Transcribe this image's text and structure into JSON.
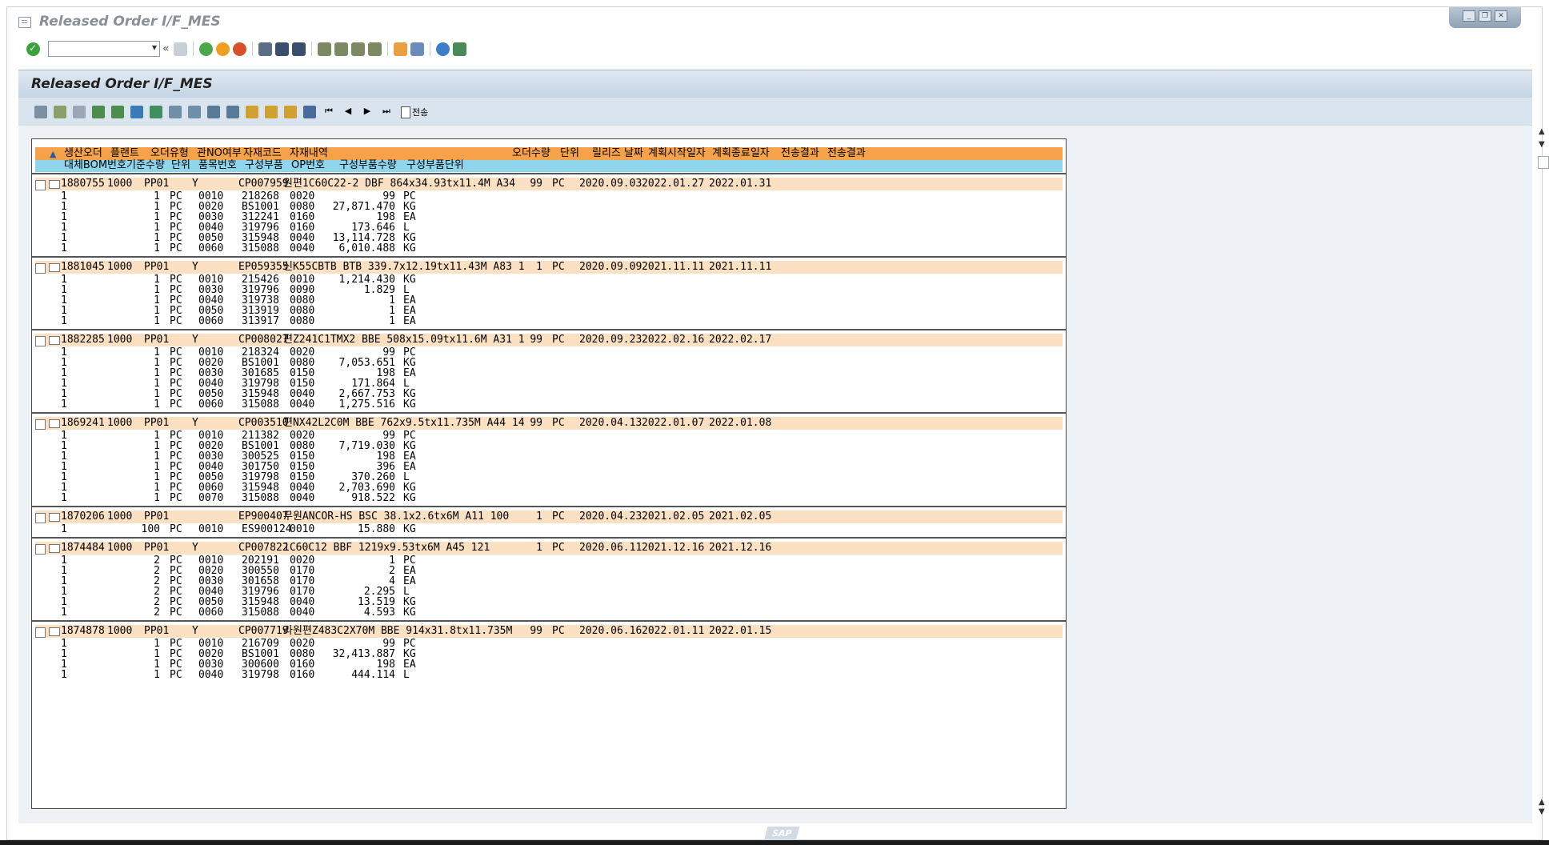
{
  "window": {
    "title": "Released Order I/F_MES"
  },
  "app": {
    "title": "Released Order I/F_MES",
    "send_button": "전송"
  },
  "command_field": {
    "value": ""
  },
  "header_row1": [
    "생산오더",
    "플랜트",
    "오더유형",
    "관NO여부",
    "자재코드",
    "자재내역",
    "오더수량",
    "단위",
    "릴리즈 날짜",
    "계획시작일자",
    "계획종료일자",
    "전송결과",
    "전송결과"
  ],
  "header_row2": [
    "대체BOM번호",
    "기준수량",
    "단위",
    "품목번호",
    "구성부품",
    "OP번호",
    "구성부품수량",
    "구성부품단위"
  ],
  "orders": [
    {
      "order": "1880755",
      "plant": "1000",
      "type": "PP01",
      "flag": "Y",
      "material": "CP007959",
      "desc": "원편1C60C22-2 DBF 864x34.93tx11.4M A34",
      "qty": "99",
      "unit": "PC",
      "release": "2020.09.03",
      "start": "2022.01.27",
      "end": "2022.01.31",
      "items": [
        {
          "alt": "1",
          "base": "1",
          "bunit": "PC",
          "item": "0010",
          "comp": "218268",
          "op": "0020",
          "cqty": "99",
          "cunit": "PC"
        },
        {
          "alt": "1",
          "base": "1",
          "bunit": "PC",
          "item": "0020",
          "comp": "BS1001",
          "op": "0080",
          "cqty": "27,871.470",
          "cunit": "KG"
        },
        {
          "alt": "1",
          "base": "1",
          "bunit": "PC",
          "item": "0030",
          "comp": "312241",
          "op": "0160",
          "cqty": "198",
          "cunit": "EA"
        },
        {
          "alt": "1",
          "base": "1",
          "bunit": "PC",
          "item": "0040",
          "comp": "319796",
          "op": "0160",
          "cqty": "173.646",
          "cunit": "L"
        },
        {
          "alt": "1",
          "base": "1",
          "bunit": "PC",
          "item": "0050",
          "comp": "315948",
          "op": "0040",
          "cqty": "13,114.728",
          "cunit": "KG"
        },
        {
          "alt": "1",
          "base": "1",
          "bunit": "PC",
          "item": "0060",
          "comp": "315088",
          "op": "0040",
          "cqty": "6,010.488",
          "cunit": "KG"
        }
      ]
    },
    {
      "order": "1881045",
      "plant": "1000",
      "type": "PP01",
      "flag": "Y",
      "material": "EP059355",
      "desc": "신K55CBTB BTB 339.7x12.19tx11.43M A83 1",
      "qty": "1",
      "unit": "PC",
      "release": "2020.09.09",
      "start": "2021.11.11",
      "end": "2021.11.11",
      "items": [
        {
          "alt": "1",
          "base": "1",
          "bunit": "PC",
          "item": "0010",
          "comp": "215426",
          "op": "0010",
          "cqty": "1,214.430",
          "cunit": "KG"
        },
        {
          "alt": "1",
          "base": "1",
          "bunit": "PC",
          "item": "0030",
          "comp": "319796",
          "op": "0090",
          "cqty": "1.829",
          "cunit": "L"
        },
        {
          "alt": "1",
          "base": "1",
          "bunit": "PC",
          "item": "0040",
          "comp": "319738",
          "op": "0080",
          "cqty": "1",
          "cunit": "EA"
        },
        {
          "alt": "1",
          "base": "1",
          "bunit": "PC",
          "item": "0050",
          "comp": "313919",
          "op": "0080",
          "cqty": "1",
          "cunit": "EA"
        },
        {
          "alt": "1",
          "base": "1",
          "bunit": "PC",
          "item": "0060",
          "comp": "313917",
          "op": "0080",
          "cqty": "1",
          "cunit": "EA"
        }
      ]
    },
    {
      "order": "1882285",
      "plant": "1000",
      "type": "PP01",
      "flag": "Y",
      "material": "CP008027",
      "desc": "편Z241C1TMX2 BBE 508x15.09tx11.6M A31 1",
      "qty": "99",
      "unit": "PC",
      "release": "2020.09.23",
      "start": "2022.02.16",
      "end": "2022.02.17",
      "items": [
        {
          "alt": "1",
          "base": "1",
          "bunit": "PC",
          "item": "0010",
          "comp": "218324",
          "op": "0020",
          "cqty": "99",
          "cunit": "PC"
        },
        {
          "alt": "1",
          "base": "1",
          "bunit": "PC",
          "item": "0020",
          "comp": "BS1001",
          "op": "0080",
          "cqty": "7,053.651",
          "cunit": "KG"
        },
        {
          "alt": "1",
          "base": "1",
          "bunit": "PC",
          "item": "0030",
          "comp": "301685",
          "op": "0150",
          "cqty": "198",
          "cunit": "EA"
        },
        {
          "alt": "1",
          "base": "1",
          "bunit": "PC",
          "item": "0040",
          "comp": "319798",
          "op": "0150",
          "cqty": "171.864",
          "cunit": "L"
        },
        {
          "alt": "1",
          "base": "1",
          "bunit": "PC",
          "item": "0050",
          "comp": "315948",
          "op": "0040",
          "cqty": "2,667.753",
          "cunit": "KG"
        },
        {
          "alt": "1",
          "base": "1",
          "bunit": "PC",
          "item": "0060",
          "comp": "315088",
          "op": "0040",
          "cqty": "1,275.516",
          "cunit": "KG"
        }
      ]
    },
    {
      "order": "1869241",
      "plant": "1000",
      "type": "PP01",
      "flag": "Y",
      "material": "CP003510",
      "desc": "편NX42L2C0M BBE 762x9.5tx11.735M A44 14",
      "qty": "99",
      "unit": "PC",
      "release": "2020.04.13",
      "start": "2022.01.07",
      "end": "2022.01.08",
      "items": [
        {
          "alt": "1",
          "base": "1",
          "bunit": "PC",
          "item": "0010",
          "comp": "211382",
          "op": "0020",
          "cqty": "99",
          "cunit": "PC"
        },
        {
          "alt": "1",
          "base": "1",
          "bunit": "PC",
          "item": "0020",
          "comp": "BS1001",
          "op": "0080",
          "cqty": "7,719.030",
          "cunit": "KG"
        },
        {
          "alt": "1",
          "base": "1",
          "bunit": "PC",
          "item": "0030",
          "comp": "300525",
          "op": "0150",
          "cqty": "198",
          "cunit": "EA"
        },
        {
          "alt": "1",
          "base": "1",
          "bunit": "PC",
          "item": "0040",
          "comp": "301750",
          "op": "0150",
          "cqty": "396",
          "cunit": "EA"
        },
        {
          "alt": "1",
          "base": "1",
          "bunit": "PC",
          "item": "0050",
          "comp": "319798",
          "op": "0150",
          "cqty": "370.260",
          "cunit": "L"
        },
        {
          "alt": "1",
          "base": "1",
          "bunit": "PC",
          "item": "0060",
          "comp": "315948",
          "op": "0040",
          "cqty": "2,703.690",
          "cunit": "KG"
        },
        {
          "alt": "1",
          "base": "1",
          "bunit": "PC",
          "item": "0070",
          "comp": "315088",
          "op": "0040",
          "cqty": "918.522",
          "cunit": "KG"
        }
      ]
    },
    {
      "order": "1870206",
      "plant": "1000",
      "type": "PP01",
      "flag": "",
      "material": "EP900407",
      "desc": "무원ANCOR-HS BSC 38.1x2.6tx6M A11 100",
      "qty": "1",
      "unit": "PC",
      "release": "2020.04.23",
      "start": "2021.02.05",
      "end": "2021.02.05",
      "items": [
        {
          "alt": "1",
          "base": "100",
          "bunit": "PC",
          "item": "0010",
          "comp": "ES900124",
          "op": "0010",
          "cqty": "15.880",
          "cunit": "KG"
        }
      ]
    },
    {
      "order": "1874484",
      "plant": "1000",
      "type": "PP01",
      "flag": "Y",
      "material": "CP007822",
      "desc": "1C60C12 BBF 1219x9.53tx6M A45 121",
      "qty": "1",
      "unit": "PC",
      "release": "2020.06.11",
      "start": "2021.12.16",
      "end": "2021.12.16",
      "items": [
        {
          "alt": "1",
          "base": "2",
          "bunit": "PC",
          "item": "0010",
          "comp": "202191",
          "op": "0020",
          "cqty": "1",
          "cunit": "PC"
        },
        {
          "alt": "1",
          "base": "2",
          "bunit": "PC",
          "item": "0020",
          "comp": "300550",
          "op": "0170",
          "cqty": "2",
          "cunit": "EA"
        },
        {
          "alt": "1",
          "base": "2",
          "bunit": "PC",
          "item": "0030",
          "comp": "301658",
          "op": "0170",
          "cqty": "4",
          "cunit": "EA"
        },
        {
          "alt": "1",
          "base": "2",
          "bunit": "PC",
          "item": "0040",
          "comp": "319796",
          "op": "0170",
          "cqty": "2.295",
          "cunit": "L"
        },
        {
          "alt": "1",
          "base": "2",
          "bunit": "PC",
          "item": "0050",
          "comp": "315948",
          "op": "0040",
          "cqty": "13.519",
          "cunit": "KG"
        },
        {
          "alt": "1",
          "base": "2",
          "bunit": "PC",
          "item": "0060",
          "comp": "315088",
          "op": "0040",
          "cqty": "4.593",
          "cunit": "KG"
        }
      ]
    },
    {
      "order": "1874878",
      "plant": "1000",
      "type": "PP01",
      "flag": "Y",
      "material": "CP007719",
      "desc": "라원편Z483C2X70M BBE 914x31.8tx11.735M",
      "qty": "99",
      "unit": "PC",
      "release": "2020.06.16",
      "start": "2022.01.11",
      "end": "2022.01.15",
      "items": [
        {
          "alt": "1",
          "base": "1",
          "bunit": "PC",
          "item": "0010",
          "comp": "216709",
          "op": "0020",
          "cqty": "99",
          "cunit": "PC"
        },
        {
          "alt": "1",
          "base": "1",
          "bunit": "PC",
          "item": "0020",
          "comp": "BS1001",
          "op": "0080",
          "cqty": "32,413.887",
          "cunit": "KG"
        },
        {
          "alt": "1",
          "base": "1",
          "bunit": "PC",
          "item": "0030",
          "comp": "300600",
          "op": "0160",
          "cqty": "198",
          "cunit": "EA"
        },
        {
          "alt": "1",
          "base": "1",
          "bunit": "PC",
          "item": "0040",
          "comp": "319798",
          "op": "0160",
          "cqty": "444.114",
          "cunit": "L"
        }
      ]
    }
  ],
  "colors": {
    "header_orange": "#f6a24a",
    "header_cyan": "#8fd5ec",
    "main_row": "#fbe0c2",
    "toolbar_bg": "#d9e4ef"
  },
  "footer": {
    "logo": "SAP"
  }
}
